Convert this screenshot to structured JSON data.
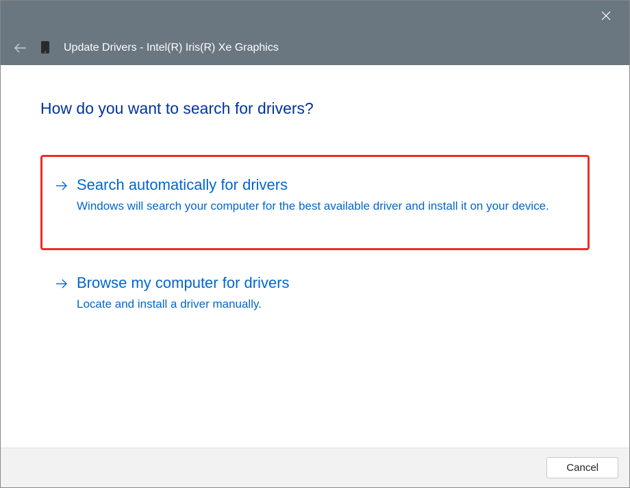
{
  "titlebar": {
    "window_title": "Update Drivers - Intel(R) Iris(R) Xe Graphics"
  },
  "content": {
    "heading": "How do you want to search for drivers?",
    "options": [
      {
        "title": "Search automatically for drivers",
        "description": "Windows will search your computer for the best available driver and install it on your device."
      },
      {
        "title": "Browse my computer for drivers",
        "description": "Locate and install a driver manually."
      }
    ]
  },
  "footer": {
    "cancel_label": "Cancel"
  }
}
